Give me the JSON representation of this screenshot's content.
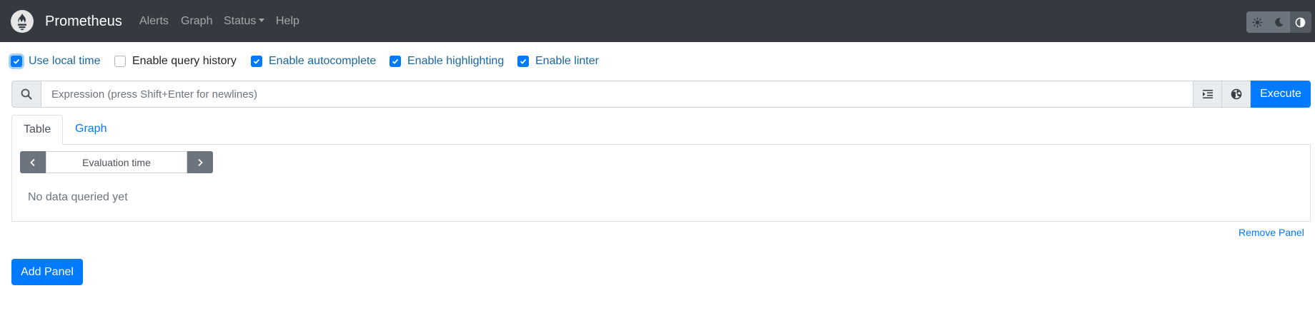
{
  "navbar": {
    "brand": "Prometheus",
    "logo_icon": "prometheus-flame-icon",
    "links": {
      "alerts": "Alerts",
      "graph": "Graph",
      "status": "Status",
      "help": "Help"
    },
    "theme_toggles": [
      "light-theme-icon",
      "dark-theme-icon",
      "browser-theme-icon"
    ]
  },
  "options": {
    "use_local_time": {
      "label": "Use local time",
      "checked": true
    },
    "enable_query_history": {
      "label": "Enable query history",
      "checked": false
    },
    "enable_autocomplete": {
      "label": "Enable autocomplete",
      "checked": true
    },
    "enable_highlighting": {
      "label": "Enable highlighting",
      "checked": true
    },
    "enable_linter": {
      "label": "Enable linter",
      "checked": true
    }
  },
  "expression": {
    "value": "",
    "placeholder": "Expression (press Shift+Enter for newlines)",
    "execute_label": "Execute"
  },
  "panel": {
    "tabs": {
      "table": "Table",
      "graph": "Graph"
    },
    "active_tab": "table",
    "evaluation_time_placeholder": "Evaluation time",
    "empty_message": "No data queried yet",
    "remove_label": "Remove Panel"
  },
  "add_panel_label": "Add Panel",
  "colors": {
    "navbar_bg": "#343a40",
    "primary": "#007bff",
    "secondary": "#6c757d"
  }
}
